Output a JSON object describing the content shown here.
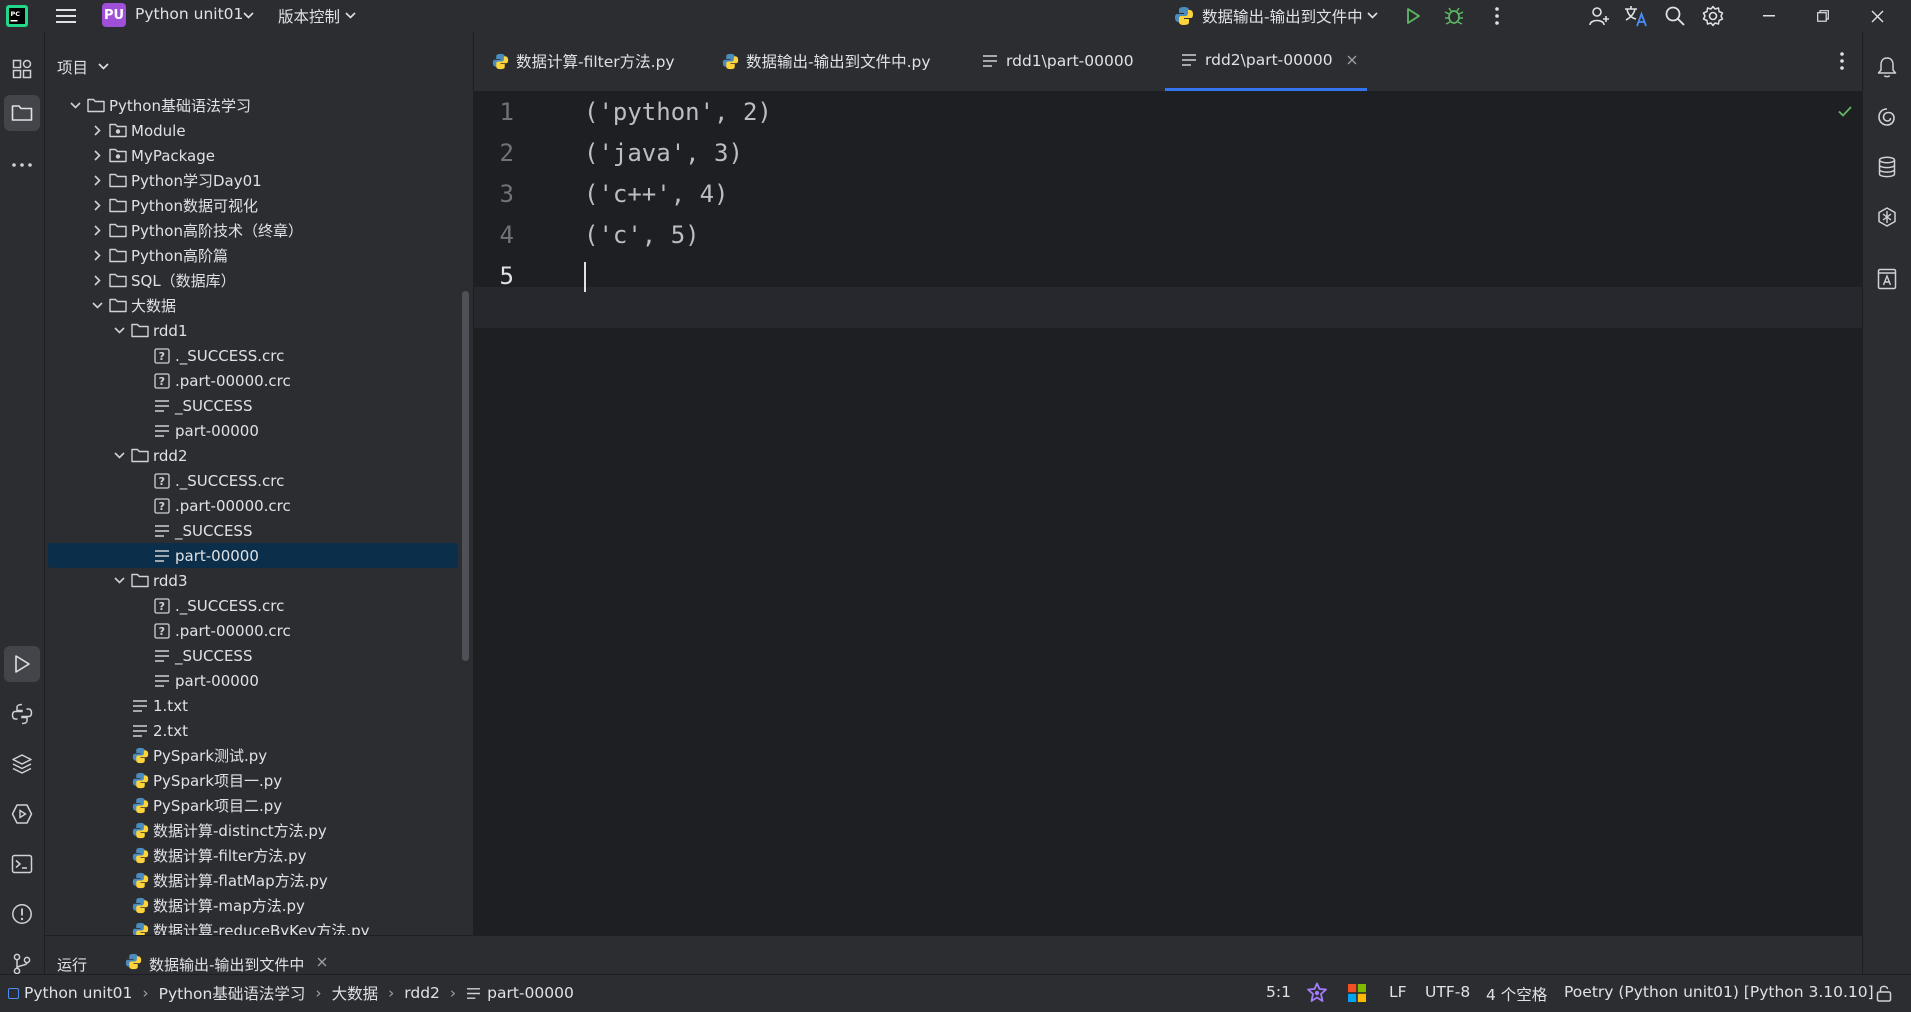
{
  "titlebar": {
    "project_badge": "PU",
    "project_name": "Python unit01",
    "vcs_label": "版本控制",
    "run_config": "数据输出-输出到文件中"
  },
  "sidebar": {
    "header": "项目",
    "tree": [
      {
        "label": "Python基础语法学习",
        "depth": 0,
        "kind": "folder",
        "expanded": true
      },
      {
        "label": "Module",
        "depth": 1,
        "kind": "package",
        "expanded": false
      },
      {
        "label": "MyPackage",
        "depth": 1,
        "kind": "package",
        "expanded": false
      },
      {
        "label": "Python学习Day01",
        "depth": 1,
        "kind": "folder",
        "expanded": false
      },
      {
        "label": "Python数据可视化",
        "depth": 1,
        "kind": "folder",
        "expanded": false
      },
      {
        "label": "Python高阶技术（终章）",
        "depth": 1,
        "kind": "folder",
        "expanded": false
      },
      {
        "label": "Python高阶篇",
        "depth": 1,
        "kind": "folder",
        "expanded": false
      },
      {
        "label": "SQL（数据库）",
        "depth": 1,
        "kind": "folder",
        "expanded": false
      },
      {
        "label": "大数据",
        "depth": 1,
        "kind": "folder",
        "expanded": true
      },
      {
        "label": "rdd1",
        "depth": 2,
        "kind": "folder",
        "expanded": true
      },
      {
        "label": "._SUCCESS.crc",
        "depth": 3,
        "kind": "unknown"
      },
      {
        "label": ".part-00000.crc",
        "depth": 3,
        "kind": "unknown"
      },
      {
        "label": "_SUCCESS",
        "depth": 3,
        "kind": "text"
      },
      {
        "label": "part-00000",
        "depth": 3,
        "kind": "text"
      },
      {
        "label": "rdd2",
        "depth": 2,
        "kind": "folder",
        "expanded": true
      },
      {
        "label": "._SUCCESS.crc",
        "depth": 3,
        "kind": "unknown"
      },
      {
        "label": ".part-00000.crc",
        "depth": 3,
        "kind": "unknown"
      },
      {
        "label": "_SUCCESS",
        "depth": 3,
        "kind": "text"
      },
      {
        "label": "part-00000",
        "depth": 3,
        "kind": "text",
        "selected": true
      },
      {
        "label": "rdd3",
        "depth": 2,
        "kind": "folder",
        "expanded": true
      },
      {
        "label": "._SUCCESS.crc",
        "depth": 3,
        "kind": "unknown"
      },
      {
        "label": ".part-00000.crc",
        "depth": 3,
        "kind": "unknown"
      },
      {
        "label": "_SUCCESS",
        "depth": 3,
        "kind": "text"
      },
      {
        "label": "part-00000",
        "depth": 3,
        "kind": "text"
      },
      {
        "label": "1.txt",
        "depth": 2,
        "kind": "text"
      },
      {
        "label": "2.txt",
        "depth": 2,
        "kind": "text"
      },
      {
        "label": "PySpark测试.py",
        "depth": 2,
        "kind": "python"
      },
      {
        "label": "PySpark项目一.py",
        "depth": 2,
        "kind": "python"
      },
      {
        "label": "PySpark项目二.py",
        "depth": 2,
        "kind": "python"
      },
      {
        "label": "数据计算-distinct方法.py",
        "depth": 2,
        "kind": "python"
      },
      {
        "label": "数据计算-filter方法.py",
        "depth": 2,
        "kind": "python"
      },
      {
        "label": "数据计算-flatMap方法.py",
        "depth": 2,
        "kind": "python"
      },
      {
        "label": "数据计算-map方法.py",
        "depth": 2,
        "kind": "python"
      },
      {
        "label": "数据计算-reduceByKey方法.py",
        "depth": 2,
        "kind": "python"
      }
    ]
  },
  "tabs": [
    {
      "label": "数据计算-filter方法.py",
      "kind": "python"
    },
    {
      "label": "数据输出-输出到文件中.py",
      "kind": "python"
    },
    {
      "label": "rdd1\\part-00000",
      "kind": "text"
    },
    {
      "label": "rdd2\\part-00000",
      "kind": "text",
      "active": true
    }
  ],
  "editor": {
    "lines": [
      "('python', 2)",
      "('java', 3)",
      "('c++', 4)",
      "('c', 5)",
      ""
    ],
    "line_numbers": [
      "1",
      "2",
      "3",
      "4",
      "5"
    ]
  },
  "runbar": {
    "label": "运行",
    "config_tab": "数据输出-输出到文件中"
  },
  "statusbar": {
    "breadcrumb": [
      "Python unit01",
      "Python基础语法学习",
      "大数据",
      "rdd2",
      "part-00000"
    ],
    "caret": "5:1",
    "line_sep": "LF",
    "encoding": "UTF-8",
    "indent": "4 个空格",
    "interpreter": "Poetry (Python unit01) [Python 3.10.10]"
  },
  "colors": {
    "accent": "#3574f0",
    "selection": "#0b2e4a",
    "badge": "#a04fd8",
    "run_green": "#5fb865"
  }
}
